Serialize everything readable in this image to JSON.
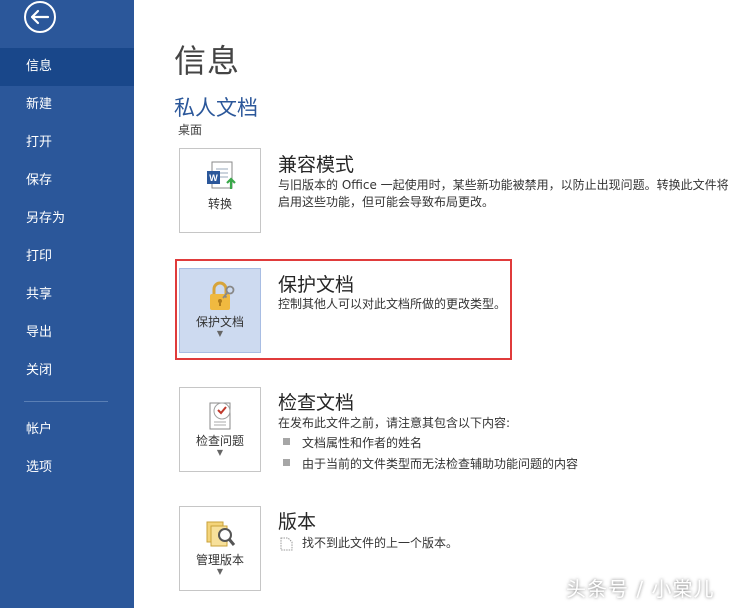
{
  "sidebar": {
    "items": [
      {
        "label": "信息"
      },
      {
        "label": "新建"
      },
      {
        "label": "打开"
      },
      {
        "label": "保存"
      },
      {
        "label": "另存为"
      },
      {
        "label": "打印"
      },
      {
        "label": "共享"
      },
      {
        "label": "导出"
      },
      {
        "label": "关闭"
      },
      {
        "label": "帐户"
      },
      {
        "label": "选项"
      }
    ]
  },
  "main": {
    "title": "信息",
    "doc_name": "私人文档",
    "doc_path": "桌面",
    "sections": {
      "compat": {
        "tile_label": "转换",
        "title": "兼容模式",
        "desc": "与旧版本的 Office 一起使用时，某些新功能被禁用，以防止出现问题。转换此文件将启用这些功能，但可能会导致布局更改。"
      },
      "protect": {
        "tile_label": "保护文档",
        "title": "保护文档",
        "desc": "控制其他人可以对此文档所做的更改类型。"
      },
      "inspect": {
        "tile_label": "检查问题",
        "title": "检查文档",
        "desc": "在发布此文件之前，请注意其包含以下内容:",
        "bullets": [
          "文档属性和作者的姓名",
          "由于当前的文件类型而无法检查辅助功能问题的内容"
        ]
      },
      "versions": {
        "tile_label": "管理版本",
        "title": "版本",
        "desc": "找不到此文件的上一个版本。"
      }
    }
  },
  "watermark": "头条号 / 小棠儿",
  "colors": {
    "sidebar": "#2b579a",
    "sidebar_active": "#19478a",
    "highlight": "#e03b3b",
    "selected_tile": "#cddaf0"
  }
}
